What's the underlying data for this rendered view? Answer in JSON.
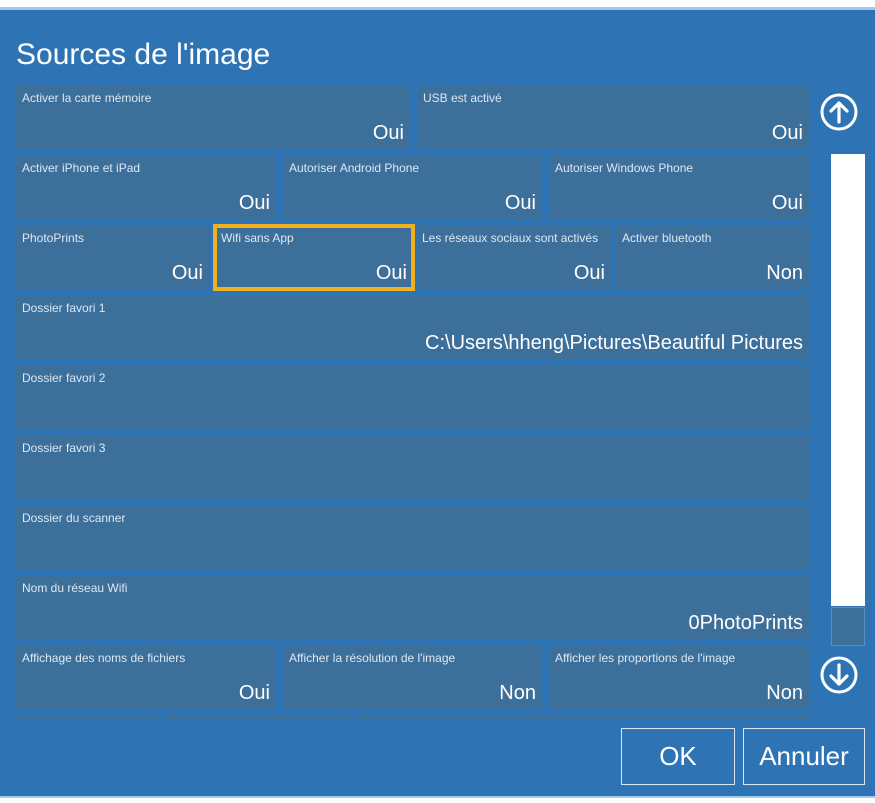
{
  "title": "Sources de l'image",
  "rows": [
    [
      {
        "label": "Activer la carte mémoire",
        "value": "Oui"
      },
      {
        "label": "USB est activé",
        "value": "Oui"
      }
    ],
    [
      {
        "label": "Activer iPhone et iPad",
        "value": "Oui"
      },
      {
        "label": "Autoriser Android Phone",
        "value": "Oui"
      },
      {
        "label": "Autoriser Windows Phone",
        "value": "Oui"
      }
    ],
    [
      {
        "label": "PhotoPrints",
        "value": "Oui"
      },
      {
        "label": "Wifi sans App",
        "value": "Oui"
      },
      {
        "label": "Les réseaux sociaux sont activés",
        "value": "Oui"
      },
      {
        "label": "Activer bluetooth",
        "value": "Non"
      }
    ],
    [
      {
        "label": "Dossier favori 1",
        "value": "C:\\Users\\hheng\\Pictures\\Beautiful Pictures"
      }
    ],
    [
      {
        "label": "Dossier favori 2",
        "value": ""
      }
    ],
    [
      {
        "label": "Dossier favori 3",
        "value": ""
      }
    ],
    [
      {
        "label": "Dossier du scanner",
        "value": ""
      }
    ],
    [
      {
        "label": "Nom du réseau Wifi",
        "value": "0PhotoPrints"
      }
    ],
    [
      {
        "label": "Affichage des noms de fichiers",
        "value": "Oui"
      },
      {
        "label": "Afficher la résolution de l'image",
        "value": "Non"
      },
      {
        "label": "Afficher les proportions de l'image",
        "value": "Non"
      }
    ]
  ],
  "selected_tile": "Wifi sans App",
  "buttons": {
    "ok": "OK",
    "cancel": "Annuler"
  },
  "icons": {
    "scroll_up": "arrow-up-circle-icon",
    "scroll_down": "arrow-down-circle-icon"
  },
  "colors": {
    "background": "#2e74b5",
    "tile": "#3d6f9b",
    "selection": "#f2b01e"
  }
}
